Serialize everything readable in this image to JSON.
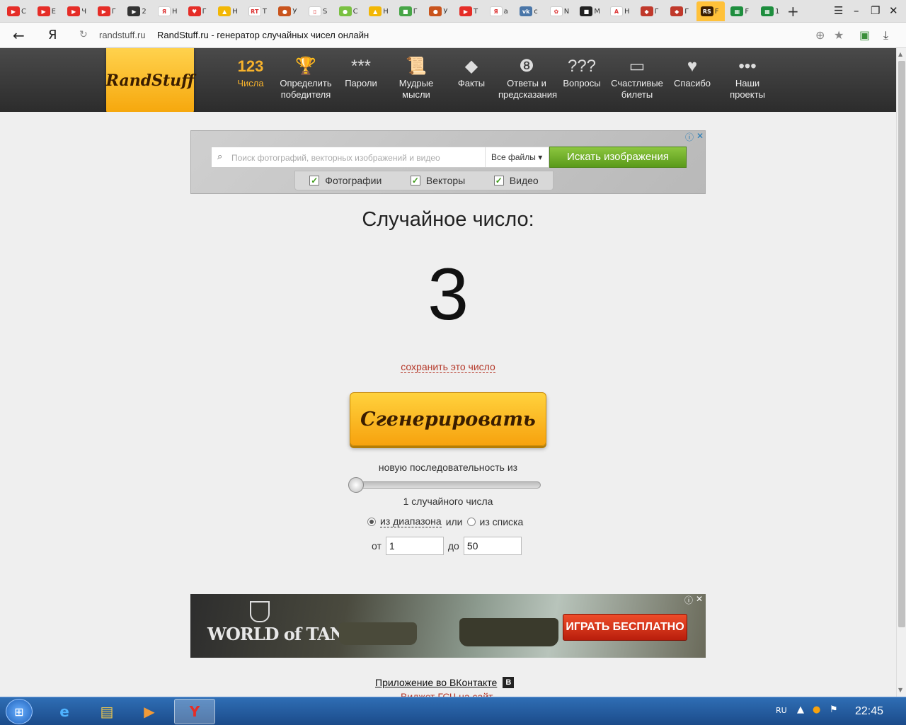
{
  "browser": {
    "tabs": [
      {
        "label": "С",
        "color": "#e52d27",
        "glyph": "▶"
      },
      {
        "label": "Е",
        "color": "#e52d27",
        "glyph": "▶"
      },
      {
        "label": "Ч",
        "color": "#e52d27",
        "glyph": "▶"
      },
      {
        "label": "Г",
        "color": "#e52d27",
        "glyph": "▶"
      },
      {
        "label": "2",
        "color": "#333333",
        "glyph": "▶"
      },
      {
        "label": "Н",
        "color": "#ffffff",
        "glyph": "Я"
      },
      {
        "label": "Г",
        "color": "#e52d27",
        "glyph": "♥"
      },
      {
        "label": "Н",
        "color": "#f2b705",
        "glyph": "▲"
      },
      {
        "label": "Т",
        "color": "#ffffff",
        "glyph": "RT"
      },
      {
        "label": "У",
        "color": "#c9541d",
        "glyph": "●"
      },
      {
        "label": "S",
        "color": "#ffffff",
        "glyph": "▯"
      },
      {
        "label": "С",
        "color": "#7ac142",
        "glyph": "●"
      },
      {
        "label": "Н",
        "color": "#f2b705",
        "glyph": "▲"
      },
      {
        "label": "Г",
        "color": "#46a546",
        "glyph": "■"
      },
      {
        "label": "У",
        "color": "#c9541d",
        "glyph": "●"
      },
      {
        "label": "Т",
        "color": "#e52d27",
        "glyph": "▶"
      },
      {
        "label": "а",
        "color": "#ffffff",
        "glyph": "Я"
      },
      {
        "label": "с",
        "color": "#4a76a8",
        "glyph": "vk"
      },
      {
        "label": "N",
        "color": "#ffffff",
        "glyph": "✿"
      },
      {
        "label": "М",
        "color": "#222222",
        "glyph": "■"
      },
      {
        "label": "Н",
        "color": "#ffffff",
        "glyph": "A"
      },
      {
        "label": "Г",
        "color": "#c0392b",
        "glyph": "◆"
      },
      {
        "label": "Г",
        "color": "#c0392b",
        "glyph": "◆"
      },
      {
        "label": "F",
        "color": "#3a1d00",
        "glyph": "RS",
        "active": true
      },
      {
        "label": "F",
        "color": "#1e8e3e",
        "glyph": "▦"
      },
      {
        "label": "1",
        "color": "#1e8e3e",
        "glyph": "▦"
      }
    ],
    "new_tab": "+",
    "url_domain": "randstuff.ru",
    "page_title": "RandStuff.ru - генератор случайных чисел онлайн",
    "back_glyph": "←",
    "search_engine_glyph": "Я"
  },
  "site": {
    "logo": "RandStuff",
    "nav": [
      {
        "icon": "123",
        "label": "Числа",
        "active": true,
        "name": "numbers"
      },
      {
        "icon": "🏆",
        "label": "Определить победителя",
        "name": "winner"
      },
      {
        "icon": "***",
        "label": "Пароли",
        "name": "passwords"
      },
      {
        "icon": "📜",
        "label": "Мудрые мысли",
        "name": "quotes"
      },
      {
        "icon": "◆",
        "label": "Факты",
        "name": "facts"
      },
      {
        "icon": "❽",
        "label": "Ответы и предсказания",
        "name": "answers"
      },
      {
        "icon": "???",
        "label": "Вопросы",
        "name": "questions"
      },
      {
        "icon": "▭",
        "label": "Счастливые билеты",
        "name": "tickets"
      },
      {
        "icon": "♥",
        "label": "Спасибо",
        "name": "thanks"
      },
      {
        "icon": "•••",
        "label": "Наши проекты",
        "name": "projects"
      }
    ]
  },
  "ad_top": {
    "placeholder": "Поиск фотографий, векторных изображений и видео",
    "filetype": "Все файлы ▾",
    "search_button": "Искать изображения",
    "checks": [
      "Фотографии",
      "Векторы",
      "Видео"
    ]
  },
  "generator": {
    "label": "Случайное число:",
    "value": "3",
    "save_link": "сохранить это число",
    "button": "Сгенерировать",
    "sequence_label": "новую последовательность из",
    "slider_value": 1,
    "count_label": "1 случайного числа",
    "mode_range": "из диапазона",
    "mode_or": "или",
    "mode_list": "из списка",
    "from_label": "от",
    "from_value": "1",
    "to_label": "до",
    "to_value": "50"
  },
  "ad_bottom": {
    "logo": "WORLD of TANKS",
    "button": "ИГРАТЬ БЕСПЛАТНО"
  },
  "footer": {
    "vk_app": "Приложение во ВКонтакте",
    "vk_badge": "B",
    "widget": "Виджет ГСЧ на сайт"
  },
  "taskbar": {
    "lang": "RU",
    "clock": "22:45"
  }
}
